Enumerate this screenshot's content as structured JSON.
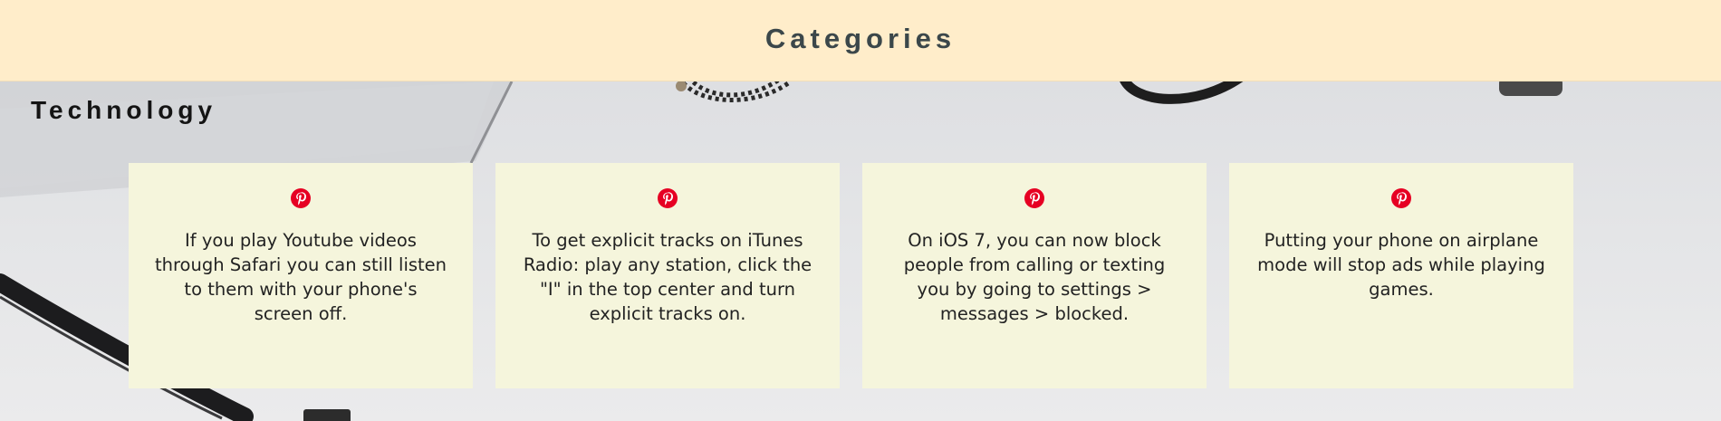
{
  "header": {
    "title": "Categories"
  },
  "section": {
    "title": "Technology"
  },
  "cards": [
    {
      "icon": "pinterest-icon",
      "text": "If you play Youtube videos through Safari you can still listen to them with your phone's screen off."
    },
    {
      "icon": "pinterest-icon",
      "text": "To get explicit tracks on iTunes Radio: play any station, click the \"I\" in the top center and turn explicit tracks on."
    },
    {
      "icon": "pinterest-icon",
      "text": "On iOS 7, you can now block people from calling or texting you by going to settings > messages > blocked."
    },
    {
      "icon": "pinterest-icon",
      "text": "Putting your phone on airplane mode will stop ads while playing games."
    }
  ],
  "colors": {
    "header_bg": "#ffedca",
    "card_bg": "#f5f5dc",
    "pinterest_red": "#e60023"
  }
}
